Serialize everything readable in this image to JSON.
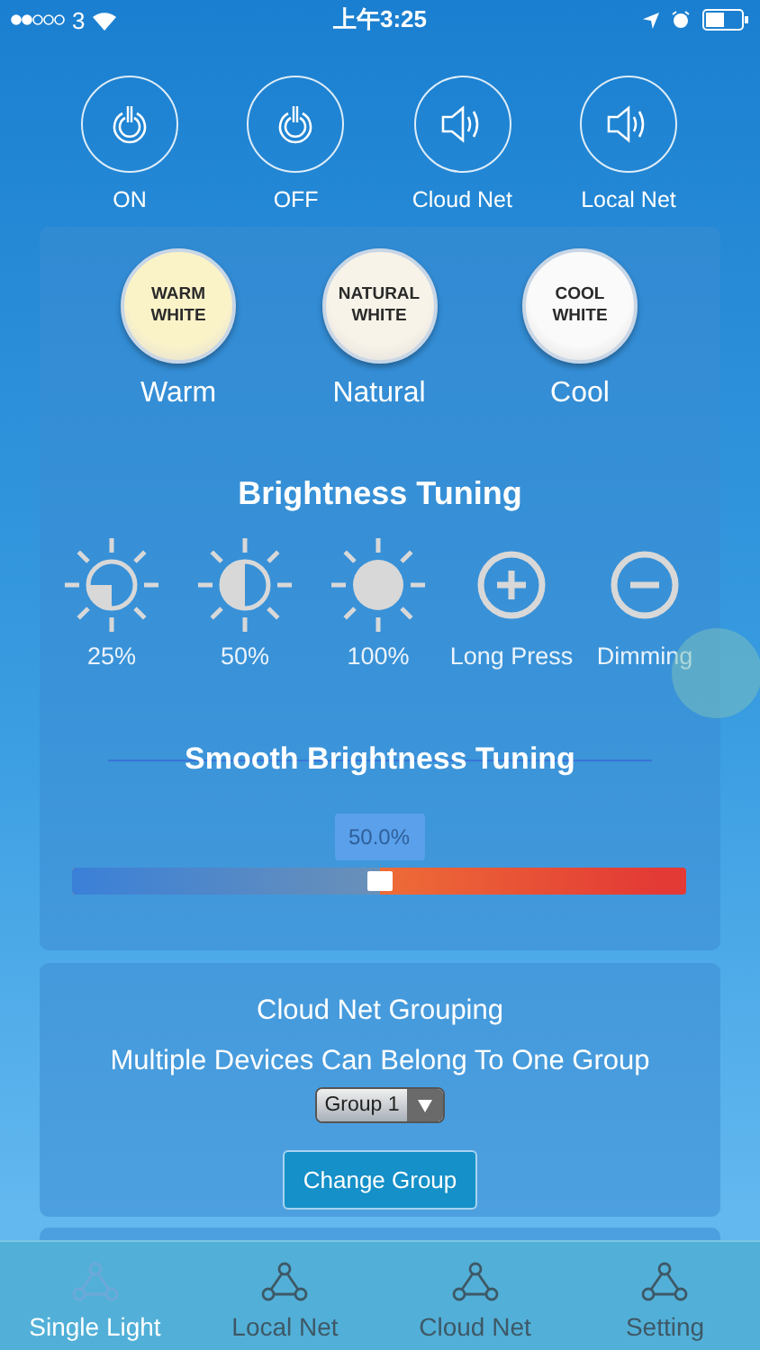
{
  "status_bar": {
    "carrier": "3",
    "time": "上午3:25"
  },
  "top_buttons": [
    {
      "label": "ON",
      "kind": "power"
    },
    {
      "label": "OFF",
      "kind": "power"
    },
    {
      "label": "Cloud Net",
      "kind": "speaker"
    },
    {
      "label": "Local Net",
      "kind": "speaker"
    }
  ],
  "presets": [
    {
      "badge_top": "WARM",
      "badge_bottom": "WHITE",
      "label": "Warm",
      "color": "#fbf3c8"
    },
    {
      "badge_top": "NATURAL",
      "badge_bottom": "WHITE",
      "label": "Natural",
      "color": "#f8f3e8"
    },
    {
      "badge_top": "COOL",
      "badge_bottom": "WHITE",
      "label": "Cool",
      "color": "#fafafa"
    }
  ],
  "brightness": {
    "title": "Brightness Tuning",
    "items": [
      {
        "label": "25%",
        "kind": "sun25"
      },
      {
        "label": "50%",
        "kind": "sun50"
      },
      {
        "label": "100%",
        "kind": "sun100"
      },
      {
        "label": "Long Press",
        "kind": "plus"
      },
      {
        "label": "Dimming",
        "kind": "minus"
      }
    ]
  },
  "smooth": {
    "title": "Smooth Brightness Tuning",
    "tooltip": "50.0%",
    "level": 0.5
  },
  "grouping": {
    "title": "Cloud Net Grouping",
    "subtitle": "Multiple Devices Can Belong To One Group",
    "dropdown": "Group 1",
    "button": "Change Group"
  },
  "tabs": [
    {
      "label": "Single Light",
      "selected": true
    },
    {
      "label": "Local Net",
      "selected": false
    },
    {
      "label": "Cloud Net",
      "selected": false
    },
    {
      "label": "Setting",
      "selected": false
    }
  ]
}
